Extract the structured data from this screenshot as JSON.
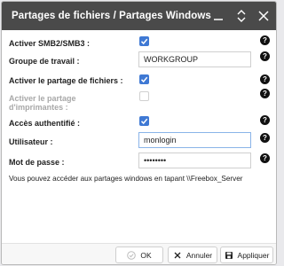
{
  "window": {
    "title": "Partages de fichiers / Partages Windows"
  },
  "form": {
    "smb": {
      "label": "Activer SMB2/SMB3 :",
      "checked": true
    },
    "workgroup": {
      "label": "Groupe de travail :",
      "value": "WORKGROUP"
    },
    "file_sharing": {
      "label": "Activer le partage de fichiers :",
      "checked": true
    },
    "printer_sharing": {
      "label_line1": "Activer le partage",
      "label_line2": "d'imprimantes :",
      "checked": false
    },
    "auth": {
      "label": "Accès authentifié :",
      "checked": true
    },
    "user": {
      "label": "Utilisateur :",
      "value": "monlogin"
    },
    "password": {
      "label": "Mot de passe :",
      "value": "••••••••"
    }
  },
  "info_text": "Vous pouvez accéder aux partages windows en tapant \\\\Freebox_Server",
  "help_glyph": "?",
  "footer": {
    "ok_label": "OK",
    "cancel_label": "Annuler",
    "apply_label": "Appliquer"
  },
  "colors": {
    "titlebar": "#4a4a4a",
    "checkbox": "#3f79d4"
  }
}
